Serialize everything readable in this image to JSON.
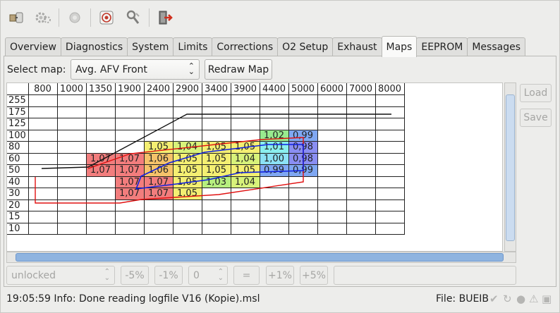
{
  "toolbar": {
    "icons": [
      "connect-icon",
      "settings-gear-icon",
      "record-icon",
      "target-icon",
      "tools-icon",
      "exit-icon"
    ]
  },
  "tabs": [
    "Overview",
    "Diagnostics",
    "System",
    "Limits",
    "Corrections",
    "O2 Setup",
    "Exhaust",
    "Maps",
    "EEPROM",
    "Messages"
  ],
  "active_tab": "Maps",
  "map_controls": {
    "select_label": "Select map:",
    "selected_map": "Avg. AFV Front",
    "redraw_label": "Redraw Map",
    "load_label": "Load",
    "save_label": "Save"
  },
  "map_table": {
    "columns": [
      "800",
      "1000",
      "1350",
      "1900",
      "2400",
      "2900",
      "3400",
      "3900",
      "4400",
      "5000",
      "6000",
      "7000",
      "8000"
    ],
    "rows": [
      {
        "label": "255",
        "cells": [
          "",
          "",
          "",
          "",
          "",
          "",
          "",
          "",
          "",
          "",
          "",
          "",
          ""
        ]
      },
      {
        "label": "175",
        "cells": [
          "",
          "",
          "",
          "",
          "",
          "",
          "",
          "",
          "",
          "",
          "",
          "",
          ""
        ]
      },
      {
        "label": "125",
        "cells": [
          "",
          "",
          "",
          "",
          "",
          "",
          "",
          "",
          "",
          "",
          "",
          "",
          ""
        ]
      },
      {
        "label": "100",
        "cells": [
          "",
          "",
          "",
          "",
          "",
          "",
          "",
          "",
          "1,02",
          "0,99",
          "",
          "",
          ""
        ]
      },
      {
        "label": "80",
        "cells": [
          "",
          "",
          "",
          "",
          "1,05",
          "1,04",
          "1,05",
          "1,05",
          "1,01",
          "0,98",
          "",
          "",
          ""
        ]
      },
      {
        "label": "60",
        "cells": [
          "",
          "",
          "1,07",
          "1,07",
          "1,06",
          "1,05",
          "1,05",
          "1,04",
          "1,00",
          "0,98",
          "",
          "",
          ""
        ]
      },
      {
        "label": "50",
        "cells": [
          "",
          "",
          "1,07",
          "1,07",
          "1,06",
          "1,05",
          "1,05",
          "1,05",
          "0,99",
          "0,99",
          "",
          "",
          ""
        ]
      },
      {
        "label": "40",
        "cells": [
          "",
          "",
          "",
          "1,07",
          "1,07",
          "1,05",
          "1,03",
          "1,04",
          "",
          "",
          "",
          "",
          ""
        ]
      },
      {
        "label": "30",
        "cells": [
          "",
          "",
          "",
          "1,07",
          "1,07",
          "1,05",
          "",
          "",
          "",
          "",
          "",
          "",
          ""
        ]
      },
      {
        "label": "20",
        "cells": [
          "",
          "",
          "",
          "",
          "",
          "",
          "",
          "",
          "",
          "",
          "",
          "",
          ""
        ]
      },
      {
        "label": "15",
        "cells": [
          "",
          "",
          "",
          "",
          "",
          "",
          "",
          "",
          "",
          "",
          "",
          "",
          ""
        ]
      },
      {
        "label": "10",
        "cells": [
          "",
          "",
          "",
          "",
          "",
          "",
          "",
          "",
          "",
          "",
          "",
          "",
          ""
        ]
      }
    ],
    "cell_colors": {
      "1,07": "#f27d7d",
      "1,06": "#f5c26a",
      "1,05": "#f4ef72",
      "1,04": "#d8f27a",
      "1,03": "#b6ef7e",
      "1,02": "#98ea8e",
      "1,01": "#8aeeee",
      "1,00": "#8ce2f5",
      "0,99": "#7fa7f2",
      "0,98": "#8a8ef2"
    }
  },
  "adjust_bar": {
    "lock_state": "unlocked",
    "minus5": "-5%",
    "minus1": "-1%",
    "value": "0",
    "equals": "=",
    "plus1": "+1%",
    "plus5": "+5%"
  },
  "status": {
    "message": "19:05:59 Info: Done reading logfile V16 (Kopie).msl",
    "file_label": "File: BUEIB"
  }
}
